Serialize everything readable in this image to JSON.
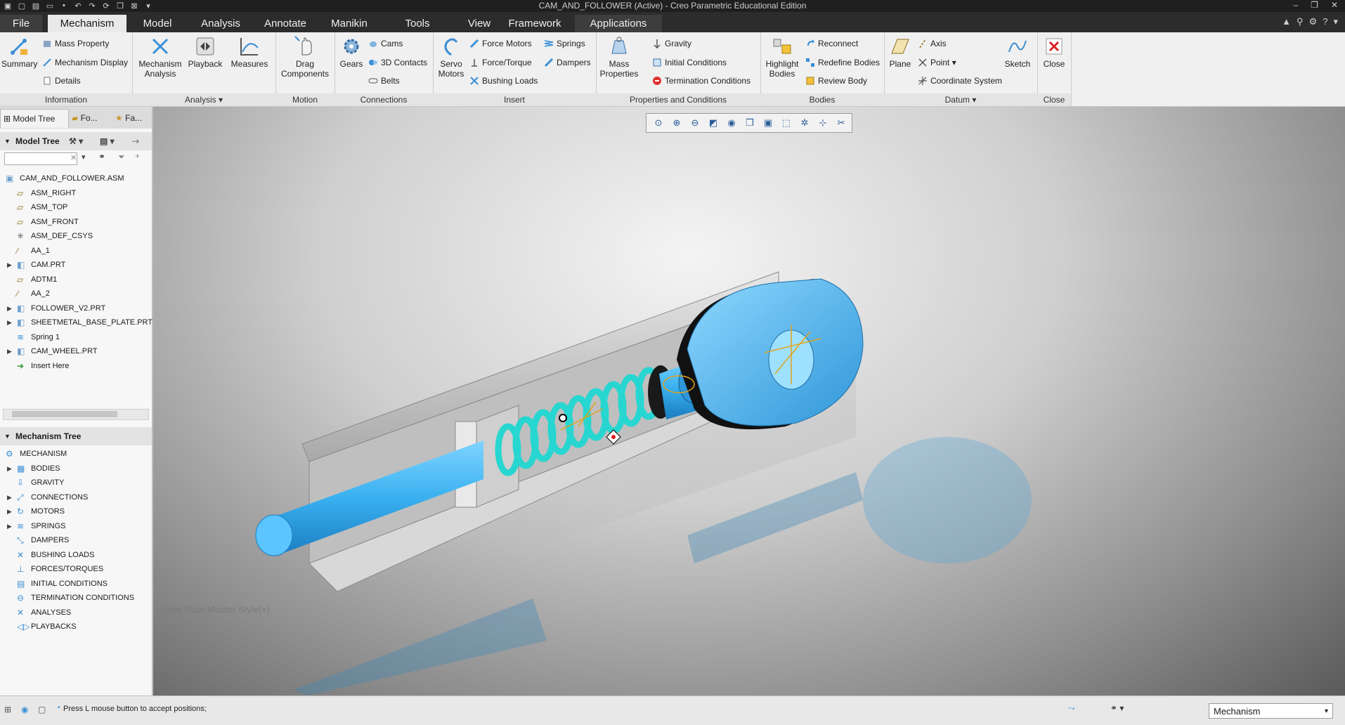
{
  "window": {
    "title": "CAM_AND_FOLLOWER (Active) - Creo Parametric Educational Edition"
  },
  "menu": {
    "tabs": [
      "File",
      "Mechanism",
      "Model",
      "Analysis",
      "Annotate",
      "Manikin",
      "Tools",
      "View",
      "Framework",
      "Applications"
    ],
    "active": "Mechanism"
  },
  "ribbon": {
    "information": {
      "label": "Information",
      "summary": "Summary",
      "mass_property": "Mass Property",
      "mechanism_display": "Mechanism Display",
      "details": "Details"
    },
    "analysis": {
      "label": "Analysis",
      "mechanism_analysis_1": "Mechanism",
      "mechanism_analysis_2": "Analysis",
      "playback": "Playback",
      "measures": "Measures"
    },
    "motion": {
      "label": "Motion",
      "drag_1": "Drag",
      "drag_2": "Components"
    },
    "connections": {
      "label": "Connections",
      "gears": "Gears",
      "cams": "Cams",
      "contacts": "3D Contacts",
      "belts": "Belts"
    },
    "insert": {
      "label": "Insert",
      "servo_1": "Servo",
      "servo_2": "Motors",
      "force_motors": "Force Motors",
      "force_torque": "Force/Torque",
      "bushing_loads": "Bushing Loads",
      "springs": "Springs",
      "dampers": "Dampers"
    },
    "properties": {
      "label": "Properties and Conditions",
      "mass_1": "Mass",
      "mass_2": "Properties",
      "gravity": "Gravity",
      "initial_conditions": "Initial Conditions",
      "termination_conditions": "Termination Conditions"
    },
    "bodies": {
      "label": "Bodies",
      "highlight_1": "Highlight",
      "highlight_2": "Bodies",
      "reconnect": "Reconnect",
      "redefine_bodies": "Redefine Bodies",
      "review_body": "Review Body"
    },
    "datum": {
      "label": "Datum",
      "plane": "Plane",
      "axis": "Axis",
      "point": "Point",
      "csys": "Coordinate System",
      "sketch": "Sketch"
    },
    "close": {
      "label": "Close",
      "close": "Close"
    }
  },
  "navigator": {
    "tabs": [
      "Model Tree",
      "Fo...",
      "Fa..."
    ],
    "model_tree_header": "Model Tree",
    "model_tree": [
      {
        "label": "CAM_AND_FOLLOWER.ASM",
        "icon": "assembly-icon",
        "expandable": false,
        "indent": 0
      },
      {
        "label": "ASM_RIGHT",
        "icon": "datum-plane-icon",
        "expandable": false,
        "indent": 1
      },
      {
        "label": "ASM_TOP",
        "icon": "datum-plane-icon",
        "expandable": false,
        "indent": 1
      },
      {
        "label": "ASM_FRONT",
        "icon": "datum-plane-icon",
        "expandable": false,
        "indent": 1
      },
      {
        "label": "ASM_DEF_CSYS",
        "icon": "csys-icon",
        "expandable": false,
        "indent": 1
      },
      {
        "label": "AA_1",
        "icon": "datum-axis-icon",
        "expandable": false,
        "indent": 1
      },
      {
        "label": "CAM.PRT",
        "icon": "part-icon",
        "expandable": true,
        "indent": 1
      },
      {
        "label": "ADTM1",
        "icon": "datum-plane-icon",
        "expandable": false,
        "indent": 1
      },
      {
        "label": "AA_2",
        "icon": "datum-axis-icon",
        "expandable": false,
        "indent": 1
      },
      {
        "label": "FOLLOWER_V2.PRT",
        "icon": "part-icon",
        "expandable": true,
        "indent": 1
      },
      {
        "label": "SHEETMETAL_BASE_PLATE.PRT",
        "icon": "part-icon",
        "expandable": true,
        "indent": 1
      },
      {
        "label": "Spring 1",
        "icon": "spring-icon",
        "expandable": false,
        "indent": 1
      },
      {
        "label": "CAM_WHEEL.PRT",
        "icon": "part-icon",
        "expandable": true,
        "indent": 1
      },
      {
        "label": "Insert Here",
        "icon": "insert-arrow-icon",
        "expandable": false,
        "indent": 1
      }
    ],
    "mechanism_tree_header": "Mechanism Tree",
    "mechanism_tree": [
      {
        "label": "MECHANISM",
        "icon": "mechanism-icon",
        "expandable": false,
        "indent": 0
      },
      {
        "label": "BODIES",
        "icon": "bodies-icon",
        "expandable": true,
        "indent": 1
      },
      {
        "label": "GRAVITY",
        "icon": "gravity-icon",
        "expandable": false,
        "indent": 1
      },
      {
        "label": "CONNECTIONS",
        "icon": "connections-icon",
        "expandable": true,
        "indent": 1
      },
      {
        "label": "MOTORS",
        "icon": "motors-icon",
        "expandable": true,
        "indent": 1
      },
      {
        "label": "SPRINGS",
        "icon": "springs-icon",
        "expandable": true,
        "indent": 1
      },
      {
        "label": "DAMPERS",
        "icon": "dampers-icon",
        "expandable": false,
        "indent": 1
      },
      {
        "label": "BUSHING LOADS",
        "icon": "bushing-icon",
        "expandable": false,
        "indent": 1
      },
      {
        "label": "FORCES/TORQUES",
        "icon": "force-icon",
        "expandable": false,
        "indent": 1
      },
      {
        "label": "INITIAL CONDITIONS",
        "icon": "initial-conditions-icon",
        "expandable": false,
        "indent": 1
      },
      {
        "label": "TERMINATION CONDITIONS",
        "icon": "termination-icon",
        "expandable": false,
        "indent": 1
      },
      {
        "label": "ANALYSES",
        "icon": "analyses-icon",
        "expandable": false,
        "indent": 1
      },
      {
        "label": "PLAYBACKS",
        "icon": "playbacks-icon",
        "expandable": false,
        "indent": 1
      }
    ]
  },
  "viewport": {
    "style_state": "Style State:Master Style(+)"
  },
  "status": {
    "message": "Press L mouse button to accept positions;",
    "mode": "Mechanism"
  },
  "colors": {
    "accent_blue": "#3aa6e8",
    "spring_cyan": "#27d6d0",
    "ribbon_bg": "#f0f0f0",
    "titlebar_bg": "#1f1f1f"
  }
}
